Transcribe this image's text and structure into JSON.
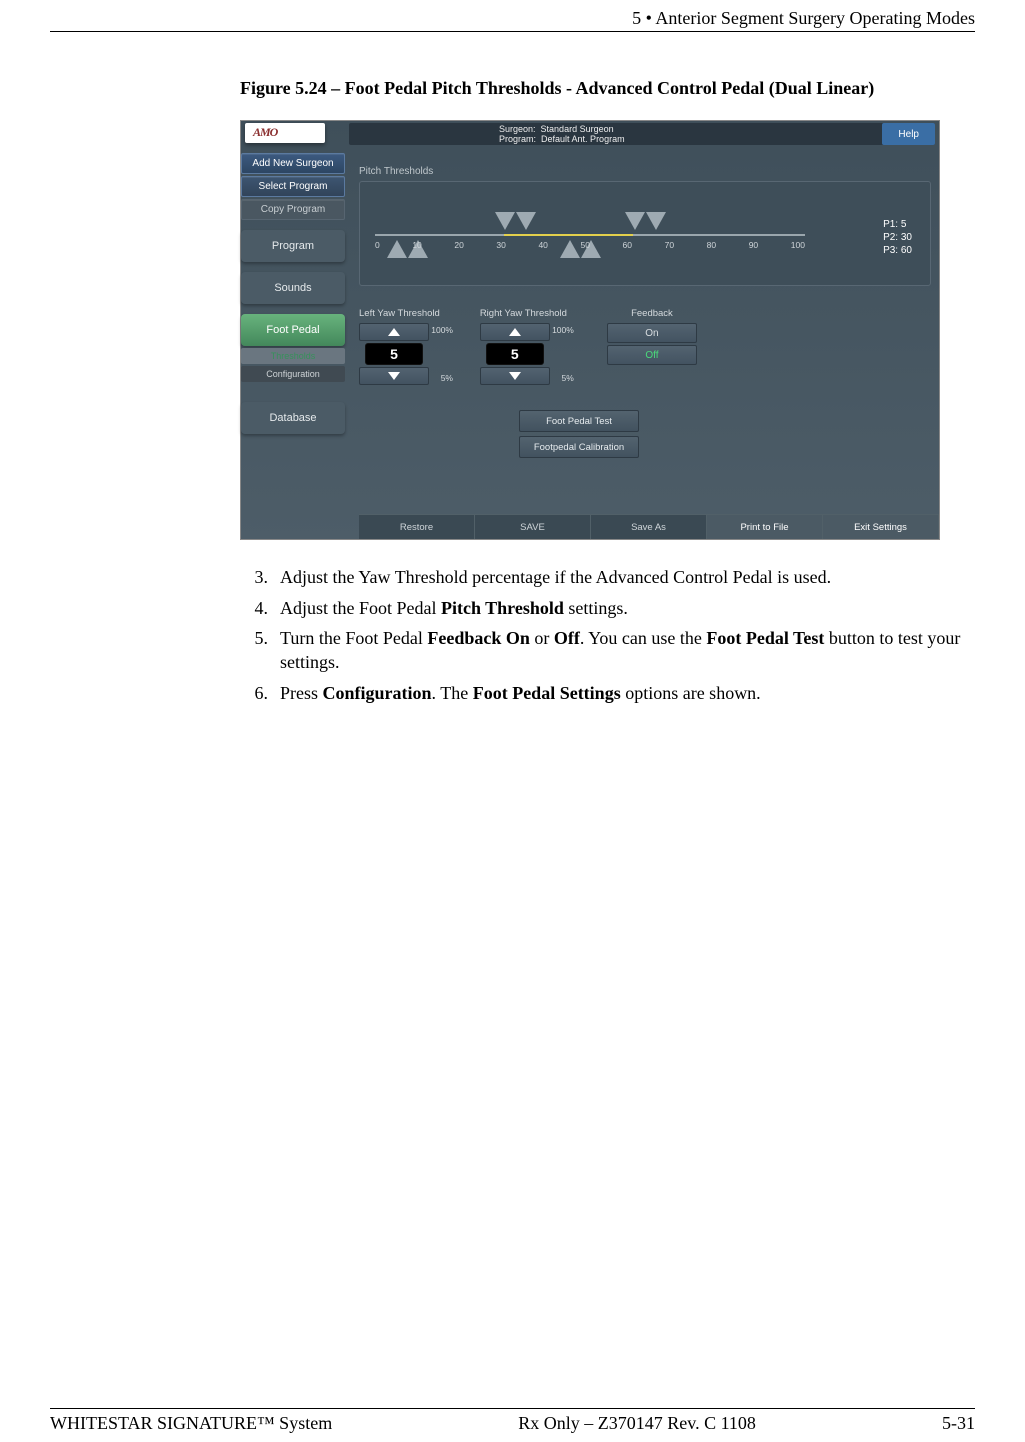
{
  "header": {
    "running_head": "5  • Anterior Segment Surgery Operating Modes"
  },
  "figure": {
    "caption_prefix": "Figure 5.24 – ",
    "caption_title": "Foot Pedal Pitch Thresholds - Advanced Control Pedal (Dual Linear)"
  },
  "screenshot": {
    "logo": "AMO",
    "surgeon_label": "Surgeon:",
    "surgeon_value": "Standard Surgeon",
    "program_label": "Program:",
    "program_value": "Default Ant. Program",
    "help": "Help",
    "sidebar": {
      "add_new_surgeon": "Add New Surgeon",
      "select_program": "Select Program",
      "copy_program": "Copy Program",
      "program": "Program",
      "sounds": "Sounds",
      "foot_pedal": "Foot Pedal",
      "thresholds": "Thresholds",
      "configuration": "Configuration",
      "database": "Database"
    },
    "panel": {
      "pitch_thresholds_title": "Pitch Thresholds",
      "ticks": [
        "0",
        "10",
        "20",
        "30",
        "40",
        "50",
        "60",
        "70",
        "80",
        "90",
        "100"
      ],
      "readout": {
        "p1": "P1: 5",
        "p2": "P2: 30",
        "p3": "P3: 60"
      },
      "left_yaw": {
        "label": "Left Yaw Threshold",
        "max": "100%",
        "value": "5",
        "min": "5%"
      },
      "right_yaw": {
        "label": "Right Yaw Threshold",
        "max": "100%",
        "value": "5",
        "min": "5%"
      },
      "feedback": {
        "label": "Feedback",
        "on": "On",
        "off": "Off"
      },
      "foot_pedal_test": "Foot Pedal Test",
      "footpedal_calibration": "Footpedal Calibration"
    },
    "bottom": {
      "restore": "Restore",
      "save": "SAVE",
      "save_as": "Save As",
      "print_to_file": "Print to File",
      "exit_settings": "Exit Settings"
    }
  },
  "steps": [
    {
      "n": "3.",
      "text_a": "Adjust the Yaw Threshold percentage if the Advanced Control Pedal is used."
    },
    {
      "n": "4.",
      "text_a": "Adjust the Foot Pedal ",
      "b1": "Pitch Threshold",
      "text_b": " settings."
    },
    {
      "n": "5.",
      "text_a": "Turn the Foot Pedal ",
      "b1": "Feedback On",
      "text_b": " or ",
      "b2": "Off",
      "text_c": ". You can use the ",
      "b3": "Foot Pedal Test",
      "text_d": " button to test your settings."
    },
    {
      "n": "6.",
      "text_a": "Press ",
      "b1": "Configuration",
      "text_b": ". The ",
      "b2": "Foot Pedal Settings",
      "text_c": " options are shown."
    }
  ],
  "footer": {
    "left": "WHITESTAR SIGNATURE™ System",
    "center": "Rx Only – Z370147 Rev. C 1108",
    "right": "5-31"
  }
}
